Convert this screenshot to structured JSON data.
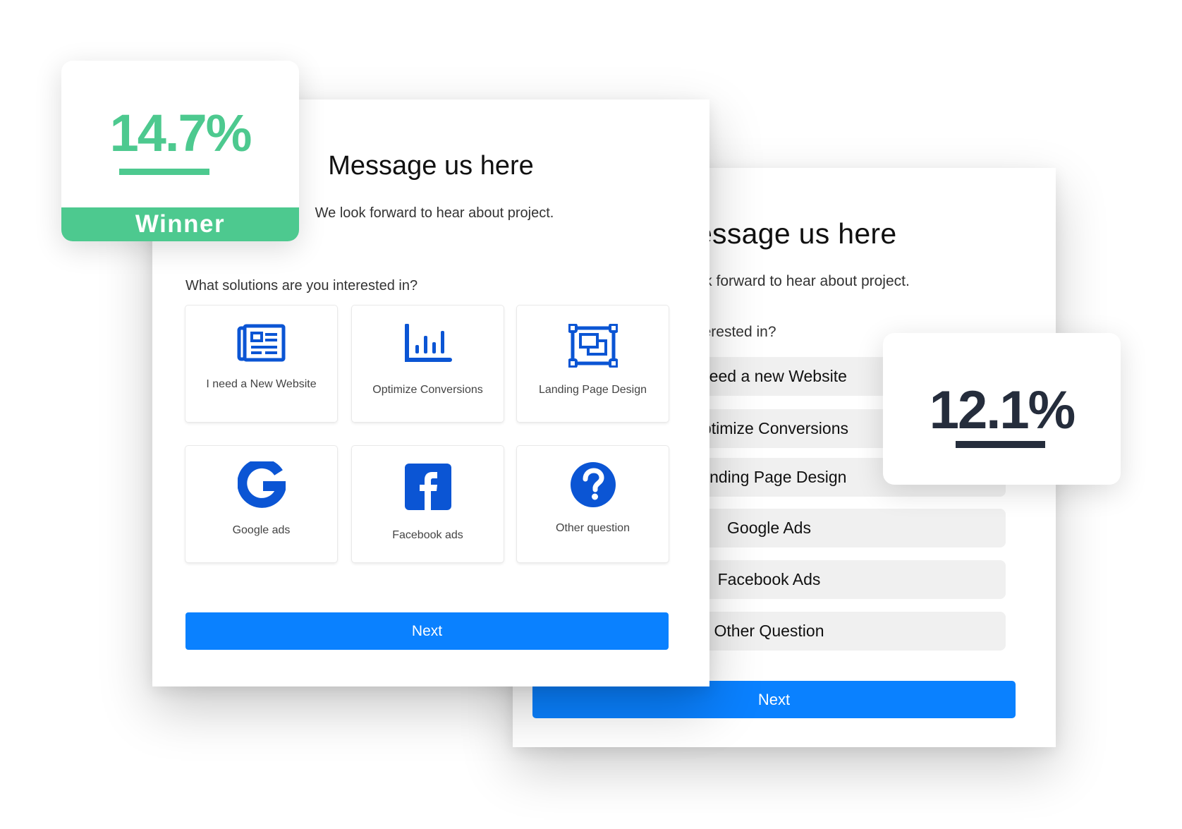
{
  "variant_a": {
    "form": {
      "title": "Message us here",
      "subtitle": "We look forward to hear about project.",
      "question": "What solutions are you interested in?",
      "options": [
        {
          "label": "I need a New Website",
          "icon": "newspaper-icon"
        },
        {
          "label": "Optimize Conversions",
          "icon": "bar-chart-icon"
        },
        {
          "label": "Landing Page Design",
          "icon": "layout-frame-icon"
        },
        {
          "label": "Google ads",
          "icon": "google-icon"
        },
        {
          "label": "Facebook ads",
          "icon": "facebook-icon"
        },
        {
          "label": "Other question",
          "icon": "question-circle-icon"
        }
      ],
      "next_label": "Next"
    },
    "result": {
      "conversion_rate": "14.7%",
      "badge": "Winner"
    }
  },
  "variant_b": {
    "form": {
      "title": "Message us here",
      "subtitle": "We look forward to hear about project.",
      "question": "What solutions are you interested in?",
      "options": [
        {
          "label": "I need a new Website"
        },
        {
          "label": "Optimize Conversions"
        },
        {
          "label": "Landing Page Design"
        },
        {
          "label": "Google Ads"
        },
        {
          "label": "Facebook Ads"
        },
        {
          "label": "Other Question"
        }
      ],
      "next_label": "Next"
    },
    "result": {
      "conversion_rate": "12.1%"
    }
  },
  "colors": {
    "winner_green": "#4dc98f",
    "loser_navy": "#252d3c",
    "button_blue": "#0a81ff",
    "icon_blue": "#0b55d4",
    "option_gray": "#f0f0f0"
  }
}
